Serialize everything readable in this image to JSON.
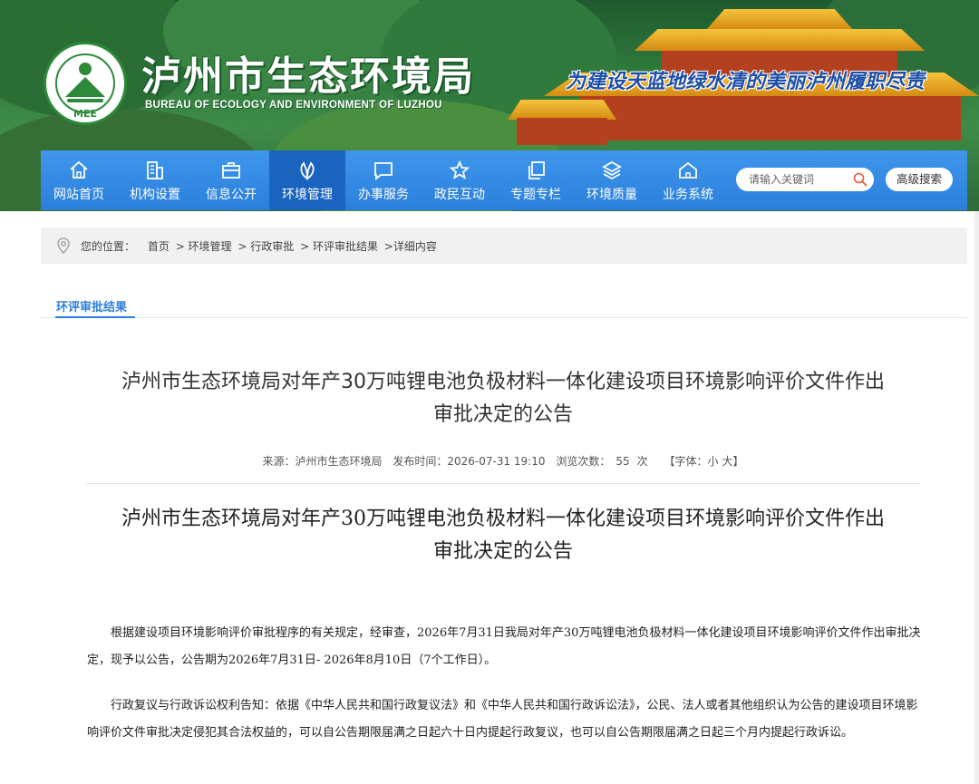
{
  "header": {
    "title": "泸州市生态环境局",
    "subtitle": "BUREAU OF ECOLOGY AND ENVIRONMENT OF LUZHOU",
    "slogan": "为建设天蓝地绿水清的美丽泸州履职尽责",
    "logo_text": "MEE"
  },
  "nav": {
    "items": [
      {
        "label": "网站首页",
        "icon": "home-icon"
      },
      {
        "label": "机构设置",
        "icon": "building-icon"
      },
      {
        "label": "信息公开",
        "icon": "briefcase-icon"
      },
      {
        "label": "环境管理",
        "icon": "leaf-icon",
        "active": true
      },
      {
        "label": "办事服务",
        "icon": "chat-icon"
      },
      {
        "label": "政民互动",
        "icon": "star-icon"
      },
      {
        "label": "专题专栏",
        "icon": "copy-icon"
      },
      {
        "label": "环境质量",
        "icon": "layers-icon"
      },
      {
        "label": "业务系统",
        "icon": "house-icon"
      }
    ],
    "search_placeholder": "请输入关键词",
    "advanced_search": "高级搜索",
    "accent": "#2b7fdc"
  },
  "breadcrumb": {
    "prefix": "您的位置：",
    "items": [
      "首页",
      " > 环境管理",
      " > 行政审批",
      " > 环评审批结果",
      " >详细内容"
    ]
  },
  "section": {
    "tab": "环评审批结果"
  },
  "article": {
    "title_line1": "泸州市生态环境局对年产30万吨锂电池负极材料一体化建设项目环境影响评价文件作出",
    "title_line2": "审批决定的公告",
    "meta": {
      "source_label": "来源：",
      "source": "泸州市生态环境局",
      "time_label": "发布时间：",
      "time": "2026-07-31 19:10",
      "views_label": "浏览次数：",
      "views": "55",
      "views_unit": "次",
      "font_label": "【字体：",
      "font_small": "小",
      "font_large": "大】"
    },
    "body_title_line1": "泸州市生态环境局对年产30万吨锂电池负极材料一体化建设项目环境影响评价文件作出",
    "body_title_line2": "审批决定的公告",
    "para1": "根据建设项目环境影响评价审批程序的有关规定，经审查，2026年7月31日我局对年产30万吨锂电池负极材料一体化建设项目环境影响评价文件作出审批决定，现予以公告，公告期为2026年7月31日- 2026年8月10日（7个工作日）。",
    "para2": "行政复议与行政诉讼权利告知：依据《中华人民共和国行政复议法》和《中华人民共和国行政诉讼法》，公民、法人或者其他组织认为公告的建设项目环境影响评价文件审批决定侵犯其合法权益的，可以自公告期限届满之日起六十日内提起行政复议，也可以自公告期限届满之日起三个月内提起行政诉讼。"
  }
}
